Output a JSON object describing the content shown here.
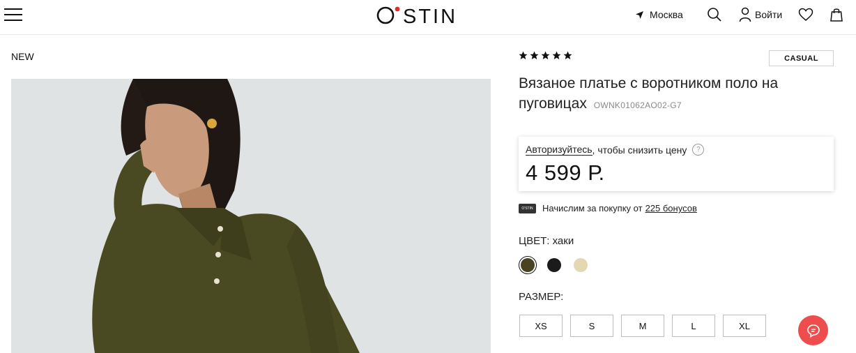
{
  "header": {
    "logo": "O STIN",
    "city": "Москва",
    "login": "Войти"
  },
  "product": {
    "badge": "NEW",
    "tag": "CASUAL",
    "rating_stars": 5,
    "title": "Вязаное платье с воротником поло на пуговицах",
    "sku": "OWNK01062AO02-G7",
    "auth_link": "Авторизуйтесь",
    "auth_rest": ", чтобы снизить цену",
    "help_icon": "?",
    "price": "4 599 Р.",
    "bonus_card": "O'STIN",
    "bonus_text": "Начислим за покупку от",
    "bonus_link": "225 бонусов",
    "color_label": "ЦВЕТ: хаки",
    "colors": [
      {
        "name": "khaki",
        "hex": "#4a4323",
        "selected": true
      },
      {
        "name": "black",
        "hex": "#1b1b1b",
        "selected": false
      },
      {
        "name": "beige",
        "hex": "#e3d8b2",
        "selected": false
      }
    ],
    "size_label": "РАЗМЕР:",
    "sizes": [
      "XS",
      "S",
      "M",
      "L",
      "XL"
    ]
  },
  "colors": {
    "brand_dot": "#e32b2b",
    "chat_button": "#ee4d4d",
    "dress": "#4a4a22"
  }
}
